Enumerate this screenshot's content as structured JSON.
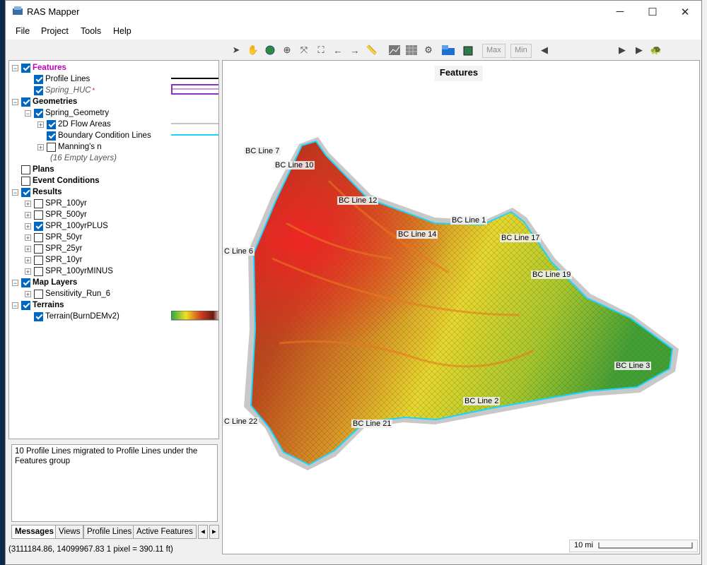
{
  "window": {
    "title": "RAS Mapper",
    "minimize": "─",
    "maximize": "☐",
    "close": "✕"
  },
  "menu": [
    "File",
    "Project",
    "Tools",
    "Help"
  ],
  "toolbar": {
    "max_label": "Max",
    "min_label": "Min"
  },
  "tree": {
    "features": {
      "label": "Features",
      "checked": true
    },
    "profile_lines": {
      "label": "Profile Lines",
      "checked": true
    },
    "spring_huc": {
      "label": "Spring_HUC",
      "checked": true,
      "marker": "*"
    },
    "geometries": {
      "label": "Geometries",
      "checked": true
    },
    "spring_geometry": {
      "label": "Spring_Geometry",
      "checked": true
    },
    "flow_areas": {
      "label": "2D Flow Areas",
      "checked": true
    },
    "bc_lines": {
      "label": "Boundary Condition Lines",
      "checked": true
    },
    "mannings": {
      "label": "Manning's n",
      "checked": false
    },
    "empty_layers": {
      "label": "(16 Empty Layers)"
    },
    "plans": {
      "label": "Plans",
      "checked": false
    },
    "event_conditions": {
      "label": "Event Conditions",
      "checked": false
    },
    "results": {
      "label": "Results",
      "checked": true
    },
    "result_items": [
      {
        "label": "SPR_100yr",
        "checked": false
      },
      {
        "label": "SPR_500yr",
        "checked": false
      },
      {
        "label": "SPR_100yrPLUS",
        "checked": true
      },
      {
        "label": "SPR_50yr",
        "checked": false
      },
      {
        "label": "SPR_25yr",
        "checked": false
      },
      {
        "label": "SPR_10yr",
        "checked": false
      },
      {
        "label": "SPR_100yrMINUS",
        "checked": false
      }
    ],
    "map_layers": {
      "label": "Map Layers",
      "checked": true
    },
    "sensitivity": {
      "label": "Sensitivity_Run_6",
      "checked": false
    },
    "terrains": {
      "label": "Terrains",
      "checked": true
    },
    "terrain_item": {
      "label": "Terrain(BurnDEMv2)",
      "checked": true
    }
  },
  "messages": {
    "text": "10 Profile Lines migrated to Profile Lines under the Features group"
  },
  "tabs": [
    "Messages",
    "Views",
    "Profile Lines",
    "Active Features"
  ],
  "status": {
    "coords": "(3111184.86, 14099967.83  1 pixel = 390.11 ft)"
  },
  "map": {
    "title": "Features",
    "scale_label": "10 mi",
    "bc_labels": [
      "BC Line 7",
      "BC Line 10",
      "BC Line 12",
      "BC Line 1",
      "BC Line 14",
      "BC Line 17",
      "C Line 6",
      "BC Line 19",
      "BC Line 3",
      "BC Line 2",
      "C Line 22",
      "BC Line 21"
    ]
  },
  "colors": {
    "accent": "#0067c0",
    "bc_line": "#1ad6ff",
    "features_label": "#c000c0",
    "huc_outline": "#9030c0"
  }
}
